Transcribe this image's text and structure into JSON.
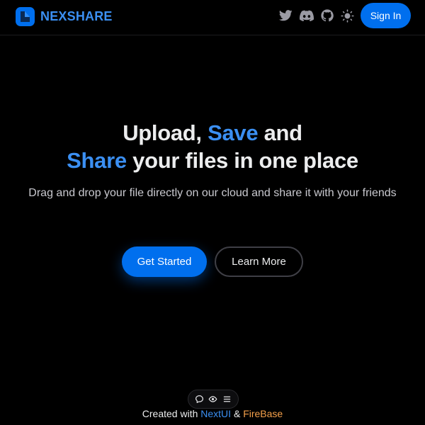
{
  "navbar": {
    "brand_name": "NEXSHARE",
    "icons": [
      "twitter-icon",
      "discord-icon",
      "github-icon",
      "theme-toggle-sun-icon"
    ],
    "signin_label": "Sign In"
  },
  "hero": {
    "title_part1": "Upload, ",
    "title_accent1": "Save",
    "title_part2": " and",
    "title_accent2": "Share",
    "title_part3": " your files in one place",
    "subtitle": "Drag and drop your file directly on our cloud and share it with your friends",
    "primary_button": "Get Started",
    "secondary_button": "Learn More"
  },
  "toolbar": {
    "icons": [
      "comment-icon",
      "eye-icon",
      "menu-icon"
    ]
  },
  "footer": {
    "prefix": "Created with ",
    "link1": "NextUI",
    "separator": " & ",
    "link2": "FireBase"
  },
  "colors": {
    "background": "#000000",
    "accent": "#3b8ff2",
    "primary_button": "#006FEE",
    "firebase_orange": "#f5a04a"
  }
}
